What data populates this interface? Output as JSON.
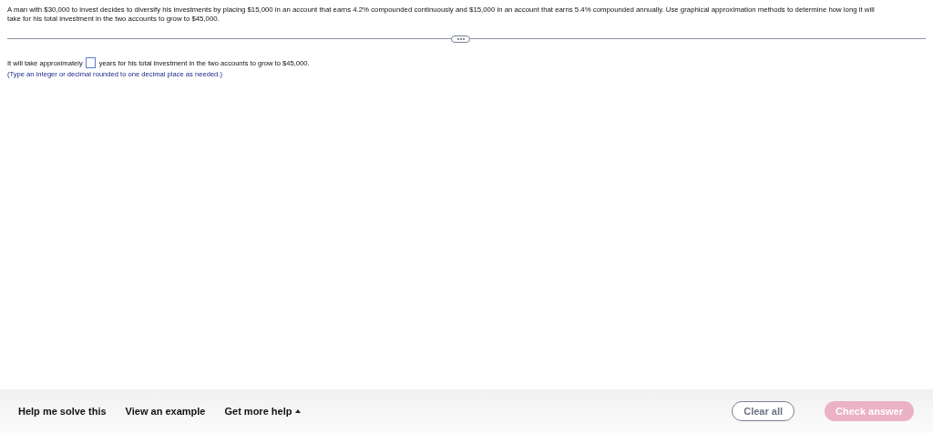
{
  "question": "A man with $30,000 to invest decides to diversify his investments by placing $15,000 in an account that earns 4.2% compounded continuously and $15,000 in an account that earns 5.4% compounded annually. Use graphical approximation methods to determine how long it will take for his total investment in the two accounts to grow to $45,000.",
  "answer": {
    "before": "It will take approximately",
    "after": "years for his total investment in the two accounts to grow to $45,000.",
    "hint": "(Type an integer or decimal rounded to one decimal place as needed.)"
  },
  "footer": {
    "links": [
      {
        "label": "Help me solve this",
        "kind": "plain"
      },
      {
        "label": "View an example",
        "kind": "plain"
      },
      {
        "label": "Get more help",
        "kind": "menu"
      }
    ],
    "buttons": [
      {
        "label": "Clear all",
        "disabled": false
      },
      {
        "label": "Check answer",
        "disabled": true
      }
    ]
  }
}
